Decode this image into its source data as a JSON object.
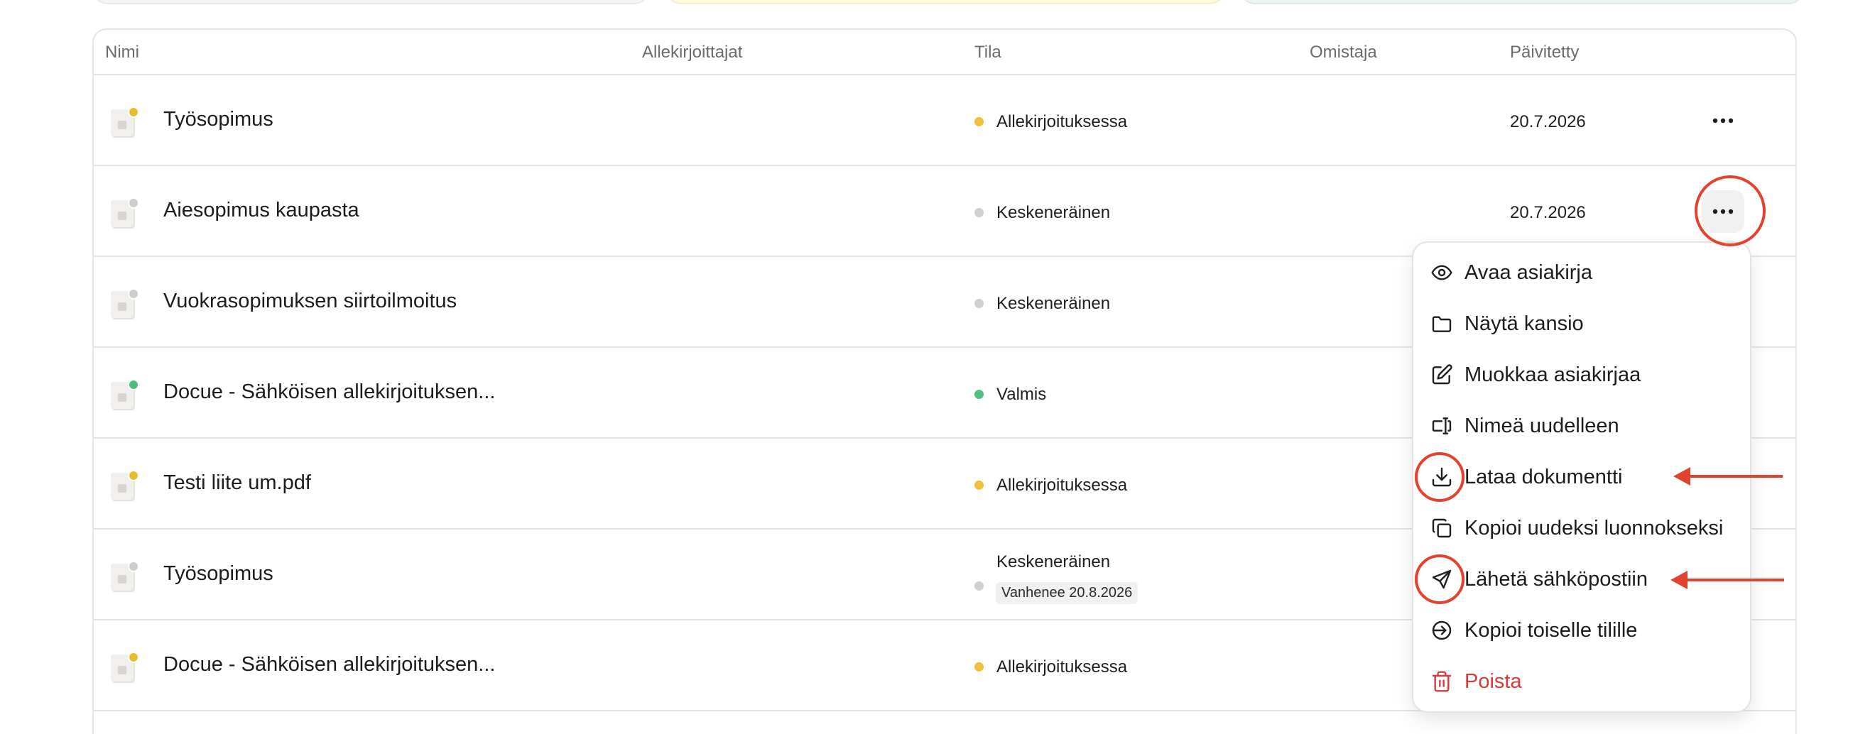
{
  "table": {
    "headers": {
      "name": "Nimi",
      "signers": "Allekirjoittajat",
      "status": "Tila",
      "owner": "Omistaja",
      "updated": "Päivitetty"
    },
    "rows": [
      {
        "name": "Työsopimus",
        "status": "Allekirjoituksessa",
        "status_color": "#eec13a",
        "date": "20.7.2026"
      },
      {
        "name": "Aiesopimus kaupasta",
        "status": "Keskeneräinen",
        "status_color": "#d2d0cd",
        "date": "20.7.2026"
      },
      {
        "name": "Vuokrasopimuksen siirtoilmoitus",
        "status": "Keskeneräinen",
        "status_color": "#d2d0cd"
      },
      {
        "name": "Docue - Sähköisen allekirjoituksen...",
        "status": "Valmis",
        "status_color": "#51c17f"
      },
      {
        "name": "Testi liite um.pdf",
        "status": "Allekirjoituksessa",
        "status_color": "#eec13a"
      },
      {
        "name": "Työsopimus",
        "status": "Keskeneräinen",
        "status_color": "#d2d0cd",
        "expiry": "Vanhenee 20.8.2026"
      },
      {
        "name": "Docue - Sähköisen allekirjoituksen...",
        "status": "Allekirjoituksessa",
        "status_color": "#eec13a"
      }
    ]
  },
  "menu": {
    "items": [
      {
        "label": "Avaa asiakirja",
        "icon": "eye-icon"
      },
      {
        "label": "Näytä kansio",
        "icon": "folder-icon"
      },
      {
        "label": "Muokkaa asiakirjaa",
        "icon": "edit-icon"
      },
      {
        "label": "Nimeä uudelleen",
        "icon": "rename-icon"
      },
      {
        "label": "Lataa dokumentti",
        "icon": "download-icon"
      },
      {
        "label": "Kopioi uudeksi luonnokseksi",
        "icon": "copy-icon"
      },
      {
        "label": "Lähetä sähköpostiin",
        "icon": "send-icon"
      },
      {
        "label": "Kopioi toiselle tilille",
        "icon": "transfer-icon"
      },
      {
        "label": "Poista",
        "icon": "trash-icon",
        "color": "#d63a3a"
      }
    ]
  },
  "annotation_color": "#e2432f"
}
